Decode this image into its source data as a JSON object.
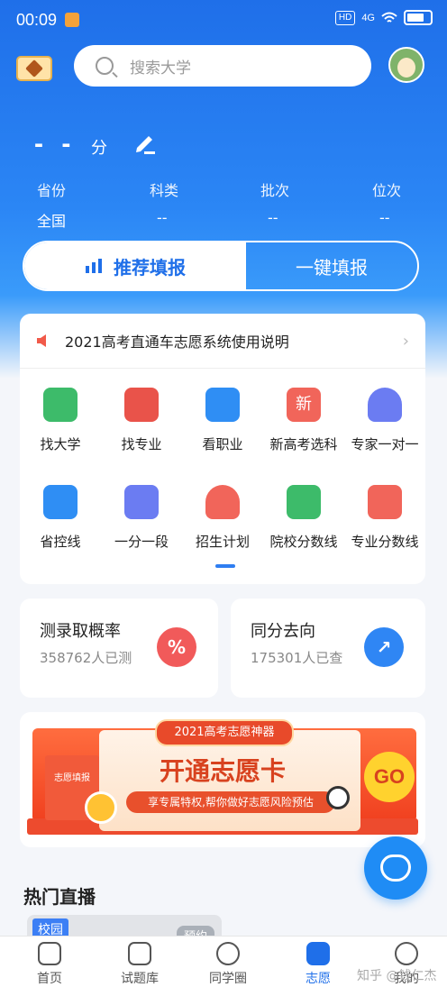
{
  "status": {
    "time": "00:09",
    "hd": "HD",
    "network": "4G"
  },
  "search": {
    "placeholder": "搜索大学"
  },
  "score": {
    "value": "- -",
    "unit": "分"
  },
  "info": [
    {
      "label": "省份",
      "value": "全国"
    },
    {
      "label": "科类",
      "value": "--"
    },
    {
      "label": "批次",
      "value": "--"
    },
    {
      "label": "位次",
      "value": "--"
    }
  ],
  "tabs": {
    "recommend": "推荐填报",
    "onekey": "一键填报"
  },
  "notice": {
    "text": "2021高考直通车志愿系统使用说明",
    "chevron": "›"
  },
  "features": [
    {
      "label": "找大学",
      "color": "#3dbb6a"
    },
    {
      "label": "找专业",
      "color": "#e9534a"
    },
    {
      "label": "看职业",
      "color": "#2f8ef4"
    },
    {
      "label": "新高考选科",
      "color": "#f1655a",
      "glyph": "新"
    },
    {
      "label": "专家一对一",
      "color": "#6b7cf2"
    },
    {
      "label": "省控线",
      "color": "#2f8ef4"
    },
    {
      "label": "一分一段",
      "color": "#6b7cf2"
    },
    {
      "label": "招生计划",
      "color": "#f1655a"
    },
    {
      "label": "院校分数线",
      "color": "#3dbb6a"
    },
    {
      "label": "专业分数线",
      "color": "#f1655a"
    }
  ],
  "mini": {
    "left": {
      "title": "测录取概率",
      "sub": "358762人已测",
      "glyph": "%",
      "color": "#f15a5a"
    },
    "right": {
      "title": "同分去向",
      "sub": "175301人已查",
      "glyph": "↗",
      "color": "#2f86f4"
    }
  },
  "banner": {
    "tag": "2021高考志愿神器",
    "title": "开通志愿卡",
    "sub": "享专属特权,帮你做好志愿风险预估",
    "go": "GO",
    "book": "志愿填报"
  },
  "hot": {
    "title": "热门直播",
    "campus": "校园",
    "pre": "预约"
  },
  "nav": [
    {
      "label": "首页"
    },
    {
      "label": "试题库"
    },
    {
      "label": "同学圈"
    },
    {
      "label": "志愿"
    },
    {
      "label": "我的"
    }
  ],
  "watermark": "知乎 @钱仁杰"
}
